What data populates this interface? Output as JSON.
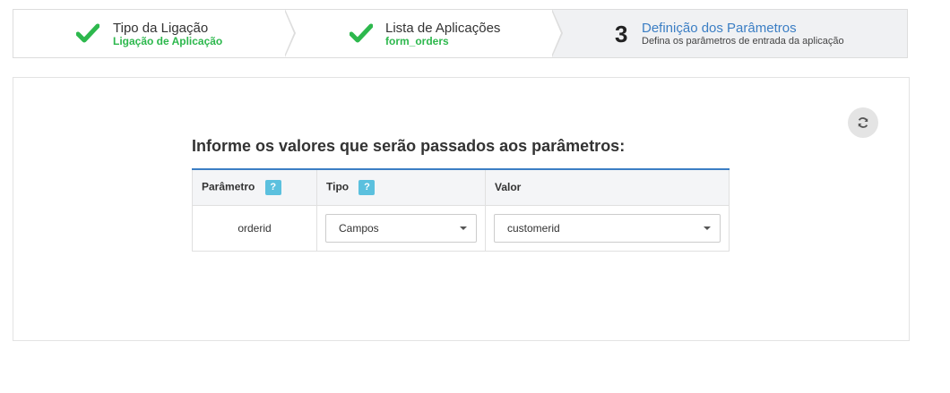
{
  "wizard": {
    "steps": [
      {
        "title": "Tipo da Ligação",
        "subtitle": "Ligação de Aplicação"
      },
      {
        "title": "Lista de Aplicações",
        "subtitle": "form_orders"
      },
      {
        "number": "3",
        "title": "Definição dos Parâmetros",
        "description": "Defina os parâmetros de entrada da aplicação"
      }
    ],
    "colors": {
      "done": "#2db84d",
      "active": "#3b7ec4"
    }
  },
  "main": {
    "heading": "Informe os valores que serão passados aos parâmetros:",
    "refresh_icon": "refresh-icon",
    "table": {
      "headers": {
        "parameter": "Parâmetro",
        "type": "Tipo",
        "value": "Valor"
      },
      "help_label": "?",
      "rows": [
        {
          "parameter": "orderid",
          "type": "Campos",
          "value": "customerid"
        }
      ]
    }
  }
}
